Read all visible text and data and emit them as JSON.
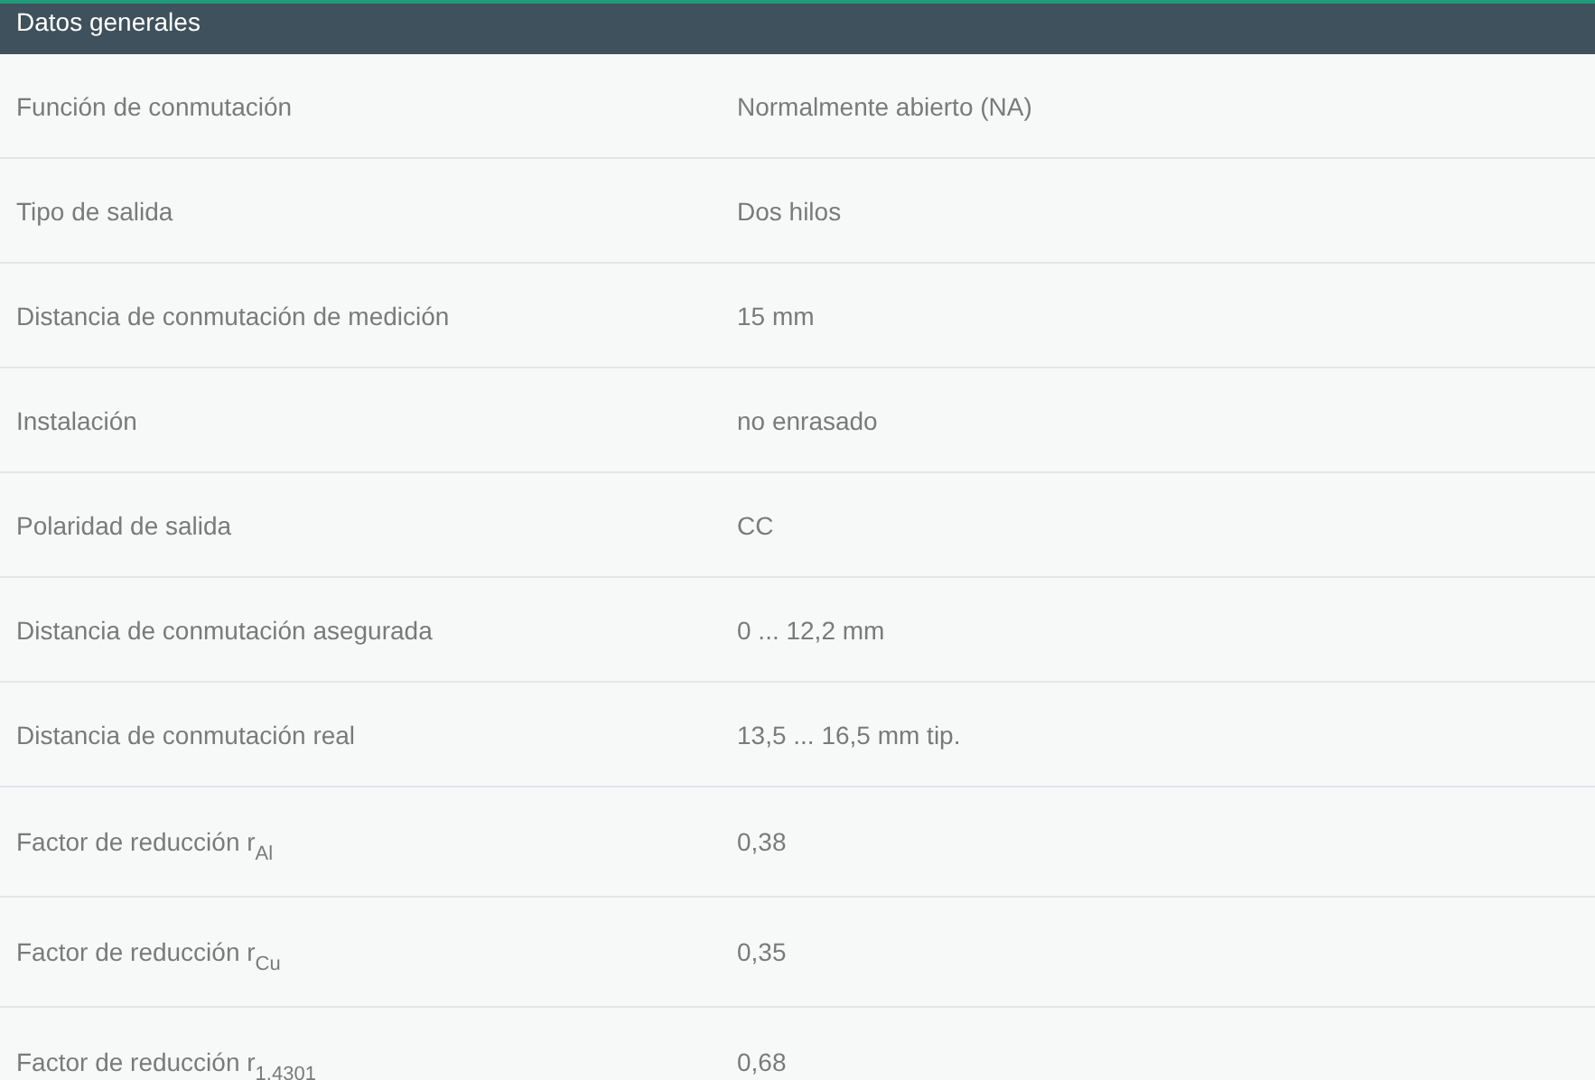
{
  "section": {
    "title": "Datos generales"
  },
  "rows": [
    {
      "label": "Función de conmutación",
      "value": "Normalmente abierto (NA)"
    },
    {
      "label": "Tipo de salida",
      "value": "Dos hilos"
    },
    {
      "label": "Distancia de conmutación de medición",
      "value": "15 mm"
    },
    {
      "label": "Instalación",
      "value": "no enrasado"
    },
    {
      "label": "Polaridad de salida",
      "value": "CC"
    },
    {
      "label": "Distancia de conmutación asegurada",
      "value": "0 ... 12,2 mm"
    },
    {
      "label": "Distancia de conmutación real",
      "value": "13,5 ... 16,5 mm tip."
    },
    {
      "label": "Factor de reducción r$_{Al}$",
      "value": "0,38"
    },
    {
      "label": "Factor de reducción r$_{Cu}$",
      "value": "0,35"
    },
    {
      "label": "Factor de reducción r$_{1.4301}$",
      "value": "0,68"
    }
  ]
}
